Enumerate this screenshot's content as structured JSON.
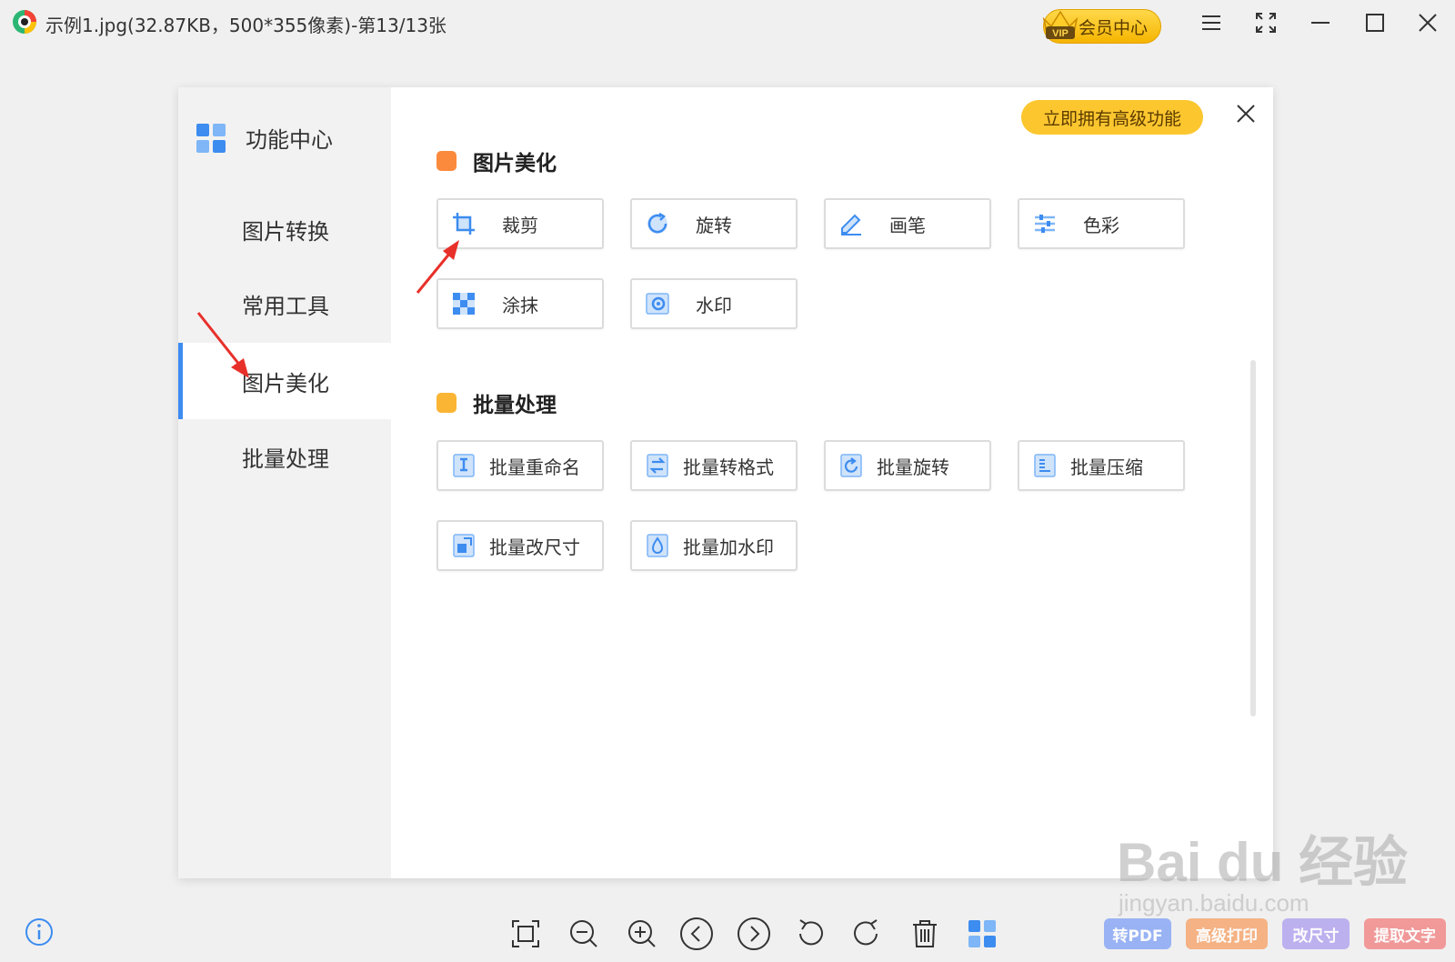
{
  "titlebar": {
    "title": "示例1.jpg(32.87KB，500*355像素)-第13/13张",
    "vip_label": "会员中心",
    "vip_badge": "VIP"
  },
  "sidebar": {
    "header": "功能中心",
    "items": [
      {
        "label": "图片转换",
        "active": false
      },
      {
        "label": "常用工具",
        "active": false
      },
      {
        "label": "图片美化",
        "active": true
      },
      {
        "label": "批量处理",
        "active": false
      }
    ]
  },
  "content": {
    "promo_label": "立即拥有高级功能",
    "sections": [
      {
        "title": "图片美化",
        "color": "#fb8a3c",
        "tools": [
          {
            "label": "裁剪",
            "icon": "crop-icon"
          },
          {
            "label": "旋转",
            "icon": "rotate-icon"
          },
          {
            "label": "画笔",
            "icon": "brush-icon"
          },
          {
            "label": "色彩",
            "icon": "color-adjust-icon"
          },
          {
            "label": "涂抹",
            "icon": "mosaic-icon"
          },
          {
            "label": "水印",
            "icon": "watermark-icon"
          }
        ]
      },
      {
        "title": "批量处理",
        "color": "#fbb534",
        "tools": [
          {
            "label": "批量重命名",
            "icon": "batch-rename-icon"
          },
          {
            "label": "批量转格式",
            "icon": "batch-convert-icon"
          },
          {
            "label": "批量旋转",
            "icon": "batch-rotate-icon"
          },
          {
            "label": "批量压缩",
            "icon": "batch-compress-icon"
          },
          {
            "label": "批量改尺寸",
            "icon": "batch-resize-icon"
          },
          {
            "label": "批量加水印",
            "icon": "batch-watermark-icon"
          }
        ]
      }
    ]
  },
  "bottom_bar": {
    "tools": [
      "fit-screen-icon",
      "zoom-out-icon",
      "zoom-in-icon",
      "previous-icon",
      "next-icon",
      "rotate-left-icon",
      "rotate-right-icon",
      "delete-icon",
      "function-center-icon"
    ],
    "pills": [
      {
        "label": "转PDF",
        "color": "#8aa8f5"
      },
      {
        "label": "高级打印",
        "color": "#f6a872"
      },
      {
        "label": "改尺寸",
        "color": "#b3a6ef"
      },
      {
        "label": "提取文字",
        "color": "#f28a8a"
      }
    ]
  },
  "watermark": {
    "brand": "Bai du 经验",
    "url": "jingyan.baidu.com"
  },
  "colors": {
    "accent": "#3d8cf0",
    "promo": "#fcc62f",
    "sidebar_bg": "#f2f2f2",
    "annotation": "#e8302a"
  }
}
